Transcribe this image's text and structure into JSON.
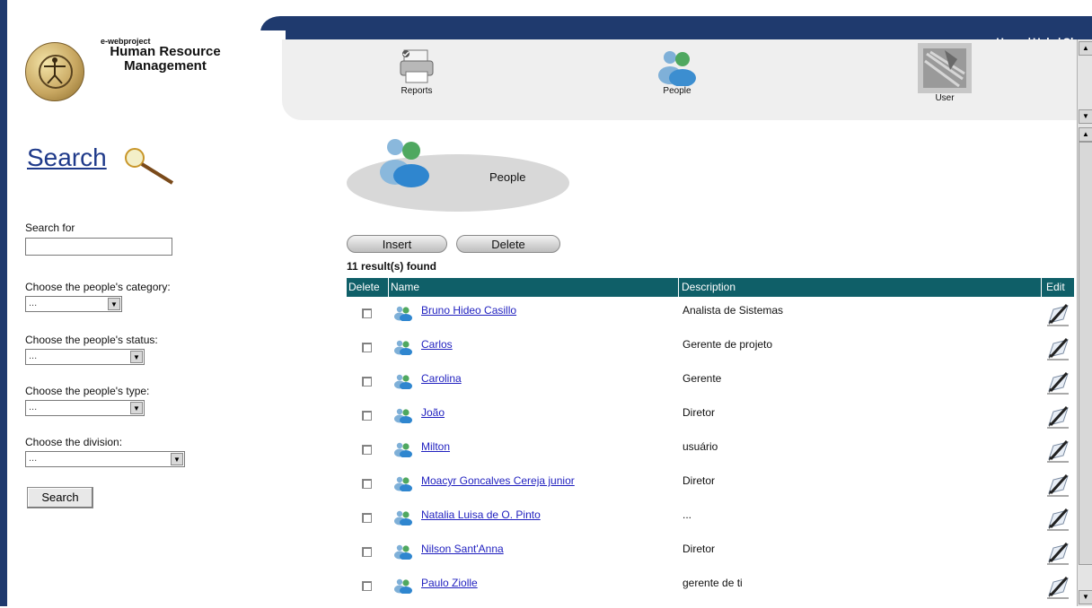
{
  "header": {
    "links": [
      "Home",
      "Help",
      "Close"
    ],
    "logo_small": "e-webproject",
    "logo_title_line1": "Human Resource",
    "logo_title_line2": "Management"
  },
  "nav": {
    "items": [
      {
        "label": "Reports",
        "icon": "printer-icon"
      },
      {
        "label": "People",
        "icon": "people-icon"
      },
      {
        "label": "User",
        "icon": "keyboard-icon"
      }
    ]
  },
  "sidebar": {
    "search_title": "Search",
    "search_for_label": "Search for",
    "search_for_value": "",
    "category_label": "Choose the people's category:",
    "category_value": "...",
    "status_label": "Choose the people's status:",
    "status_value": "...",
    "type_label": "Choose the people's type:",
    "type_value": "...",
    "division_label": "Choose the division:",
    "division_value": "...",
    "search_button": "Search"
  },
  "main": {
    "section_title": "People",
    "insert_label": "Insert",
    "delete_label": "Delete",
    "result_count": "11 result(s) found",
    "columns": [
      "Delete",
      "Name",
      "Description",
      "Edit"
    ],
    "rows": [
      {
        "name": "Bruno Hideo Casillo",
        "description": "Analista de Sistemas"
      },
      {
        "name": "Carlos",
        "description": "Gerente de projeto"
      },
      {
        "name": "Carolina",
        "description": "Gerente"
      },
      {
        "name": "João",
        "description": "Diretor"
      },
      {
        "name": "Milton",
        "description": "usuário"
      },
      {
        "name": "Moacyr Goncalves Cereja junior",
        "description": "Diretor"
      },
      {
        "name": "Natalia Luisa de O. Pinto",
        "description": "..."
      },
      {
        "name": "Nilson Sant'Anna",
        "description": "Diretor"
      },
      {
        "name": "Paulo Ziolle",
        "description": "gerente de ti"
      }
    ]
  },
  "colors": {
    "frame": "#1f3a6e",
    "table_header": "#0f5f68",
    "link": "#1f1fbf"
  }
}
